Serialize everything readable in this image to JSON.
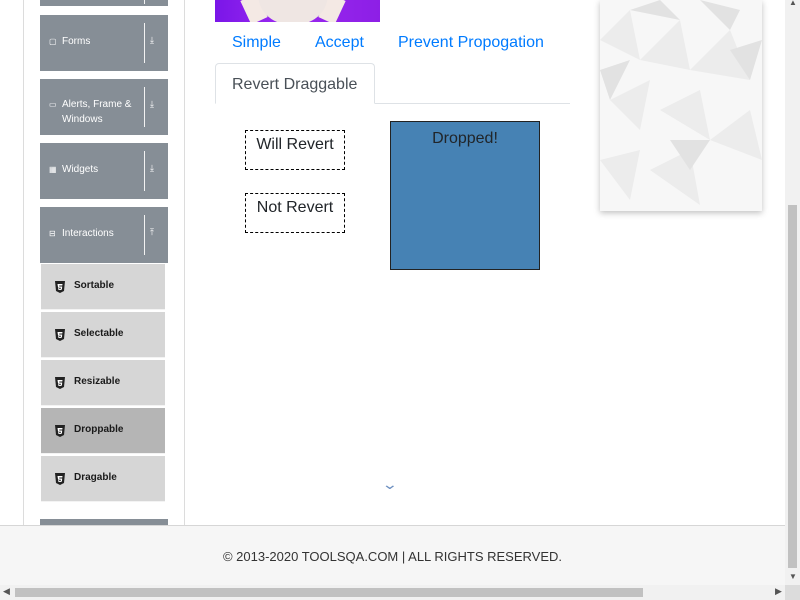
{
  "sidebar": {
    "groups": [
      {
        "label": "Forms",
        "icon": "file-icon",
        "arrow": "download-icon"
      },
      {
        "label": "Alerts, Frame &",
        "label2": "Windows",
        "icon": "window-icon",
        "arrow": "download-icon"
      },
      {
        "label": "Widgets",
        "icon": "grid-icon",
        "arrow": "download-icon"
      },
      {
        "label": "Interactions",
        "icon": "minus-square-icon",
        "arrow": "upload-icon"
      }
    ],
    "items": [
      {
        "label": "Sortable",
        "active": false
      },
      {
        "label": "Selectable",
        "active": false
      },
      {
        "label": "Resizable",
        "active": false
      },
      {
        "label": "Droppable",
        "active": true
      },
      {
        "label": "Dragable",
        "active": false
      }
    ]
  },
  "tabs": {
    "simple": "Simple",
    "accept": "Accept",
    "prevent": "Prevent Propogation",
    "revert": "Revert Draggable"
  },
  "drag": {
    "will_revert": "Will Revert",
    "not_revert": "Not Revert",
    "drop_target": "Dropped!"
  },
  "footer": {
    "text": "© 2013-2020 TOOLSQA.COM | ALL RIGHTS RESERVED."
  },
  "colors": {
    "sidebar_group": "#868e96",
    "sidebar_item": "#d6d6d6",
    "sidebar_active": "#b5b5b5",
    "link": "#007bff",
    "drop_bg": "#4682b4"
  }
}
